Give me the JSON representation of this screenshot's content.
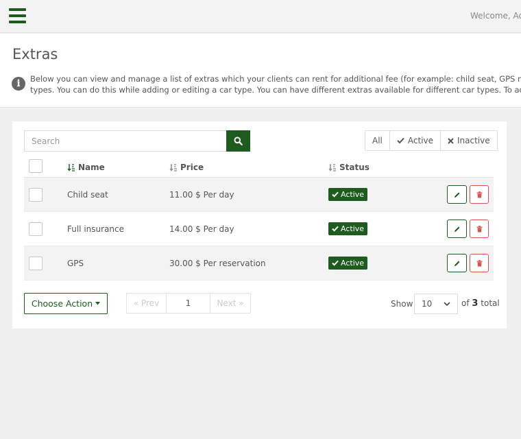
{
  "topbar": {
    "welcome_text": "Welcome, Admin"
  },
  "header": {
    "title": "Extras",
    "info_line1": "Below you can view and manage a list of extras which your clients can rent for additional fee (for example: child seat, GPS navigation, etc.) You can assign extras to car",
    "info_line2": "types. You can do this while adding or editing a car type. You can have different extras available for different car types. To add new extra, click the button."
  },
  "toolbar": {
    "search_placeholder": "Search",
    "filters": {
      "all": "All",
      "active": "Active",
      "inactive": "Inactive"
    }
  },
  "table": {
    "columns": {
      "name": "Name",
      "price": "Price",
      "status": "Status"
    },
    "rows": [
      {
        "name": "Child seat",
        "price": "11.00 $ Per day",
        "status": "Active"
      },
      {
        "name": "Full insurance",
        "price": "14.00 $ Per day",
        "status": "Active"
      },
      {
        "name": "GPS",
        "price": "30.00 $ Per reservation",
        "status": "Active"
      }
    ]
  },
  "footer": {
    "choose_action": "Choose Action",
    "prev": "« Prev",
    "page": "1",
    "next": "Next »",
    "show": "Show",
    "per_page": "10",
    "of": "of",
    "total_count": "3",
    "total_label": "total"
  },
  "colors": {
    "primary": "#1e5b1e",
    "danger": "#d9534f"
  }
}
